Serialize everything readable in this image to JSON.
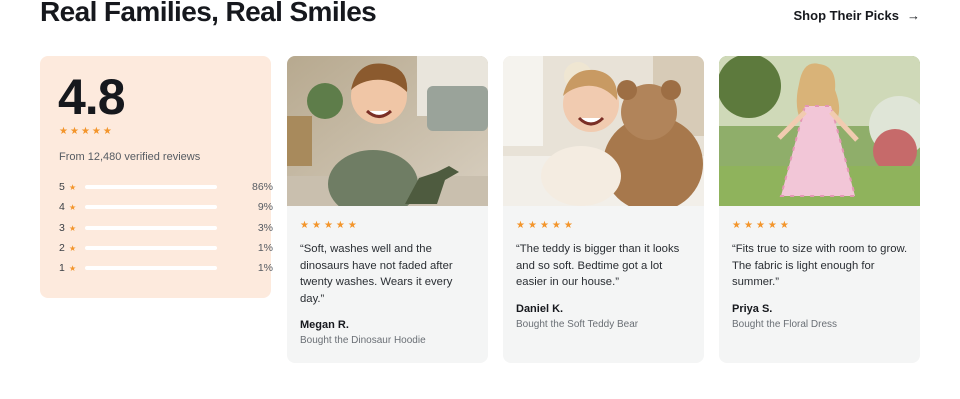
{
  "heading": "Real Families, Real Smiles",
  "shop_link": {
    "label": "Shop Their Picks",
    "icon": "arrow-right-icon"
  },
  "summary": {
    "rating": "4.8",
    "stars": 5,
    "from_text": "From 12,480 verified reviews",
    "distribution": [
      {
        "stars": "5",
        "percent_label": "86%",
        "percent": 86
      },
      {
        "stars": "4",
        "percent_label": "9%",
        "percent": 9
      },
      {
        "stars": "3",
        "percent_label": "3%",
        "percent": 3
      },
      {
        "stars": "2",
        "percent_label": "1%",
        "percent": 1
      },
      {
        "stars": "1",
        "percent_label": "1%",
        "percent": 1
      }
    ]
  },
  "reviews": [
    {
      "stars": 5,
      "quote": "“Soft, washes well and the dinosaurs have not faded after twenty washes. Wears it every day.”",
      "name": "Megan R.",
      "product": "Bought the Dinosaur Hoodie",
      "photo": "boy-with-toy-dinosaur-photo"
    },
    {
      "stars": 5,
      "quote": "“The teddy is bigger than it looks and so soft. Bedtime got a lot easier in our house.”",
      "name": "Daniel K.",
      "product": "Bought the Soft Teddy Bear",
      "photo": "child-hugging-teddy-bear-photo"
    },
    {
      "stars": 5,
      "quote": "“Fits true to size with room to grow. The fabric is light enough for summer.”",
      "name": "Priya S.",
      "product": "Bought the Floral Dress",
      "photo": "girl-in-floral-dress-photo"
    }
  ],
  "colors": {
    "accent_bar": "#e5623e",
    "star": "#f3952b",
    "summary_bg": "#fdeadd",
    "card_bg": "#f4f5f5"
  }
}
